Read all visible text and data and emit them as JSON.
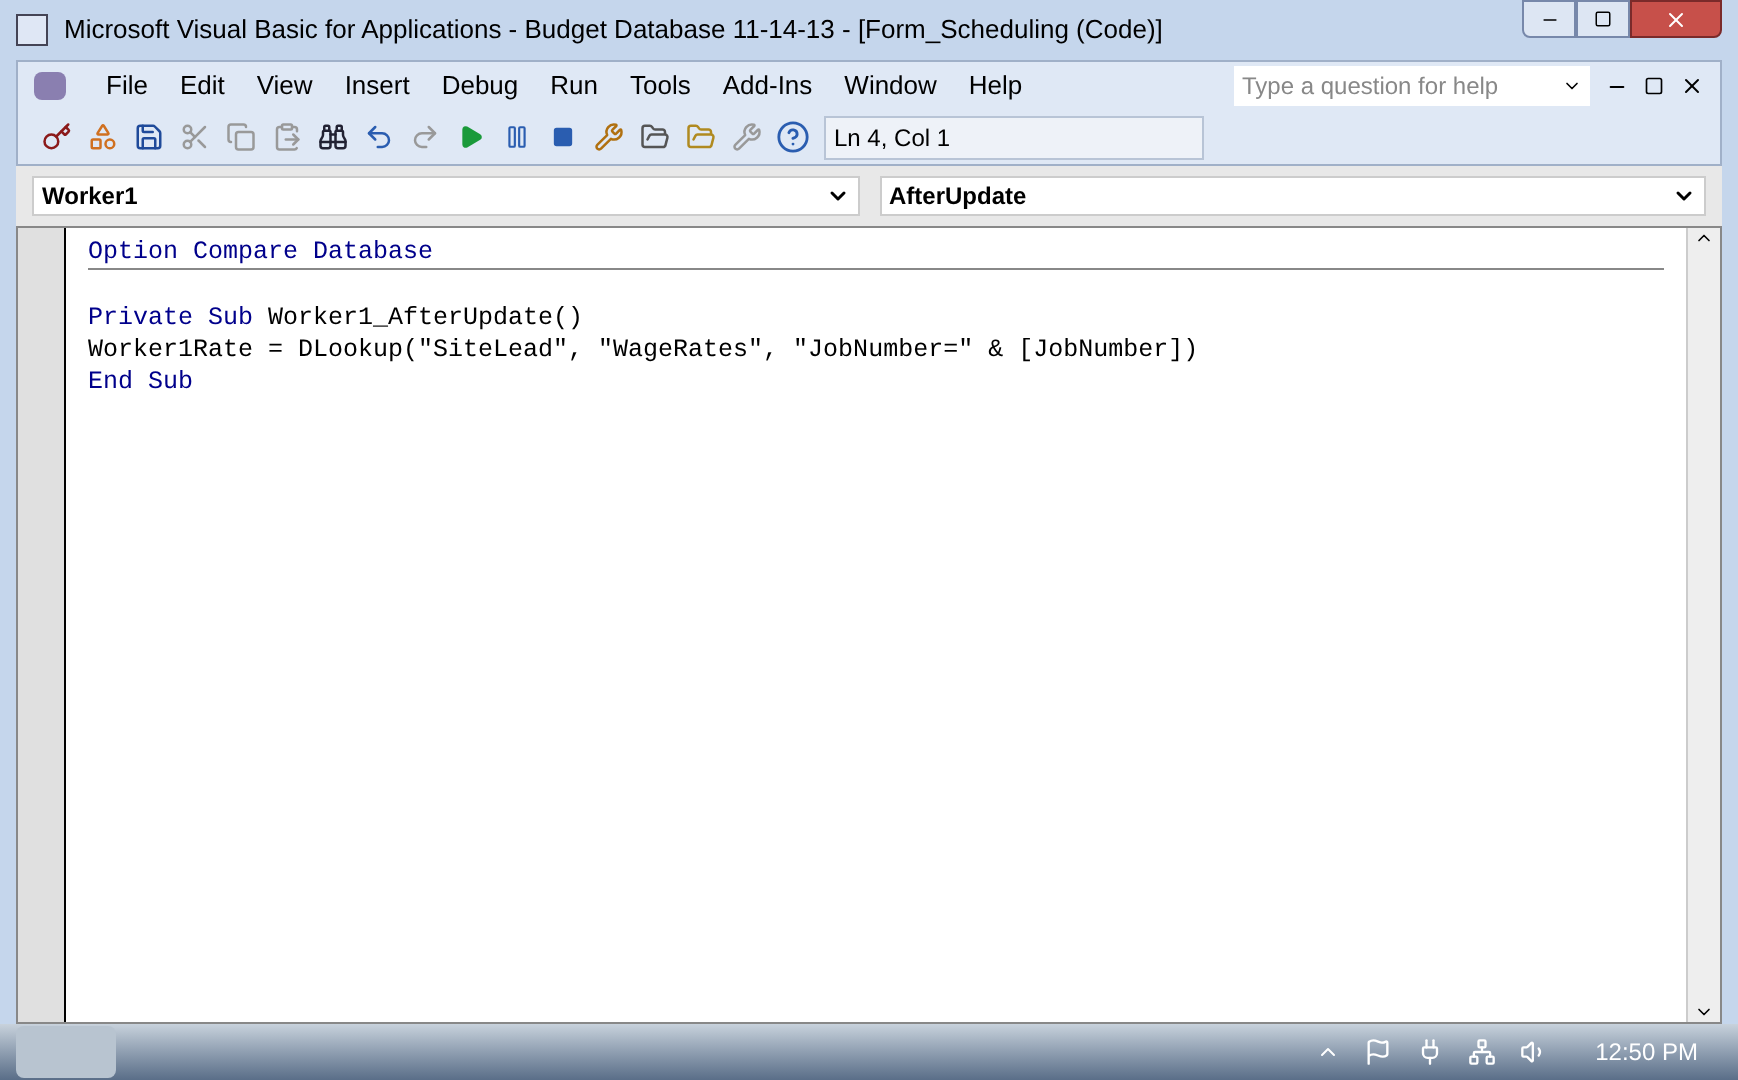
{
  "window": {
    "title": "Microsoft Visual Basic for Applications - Budget Database 11-14-13 - [Form_Scheduling (Code)]"
  },
  "menu": [
    "File",
    "Edit",
    "View",
    "Insert",
    "Debug",
    "Run",
    "Tools",
    "Add-Ins",
    "Window",
    "Help"
  ],
  "help_search": {
    "placeholder": "Type a question for help"
  },
  "toolbar": {
    "position": "Ln 4, Col 1"
  },
  "object_dropdown": {
    "value": "Worker1"
  },
  "procedure_dropdown": {
    "value": "AfterUpdate"
  },
  "code_lines": [
    [
      {
        "kind": "keyword",
        "text": "Option Compare Database"
      }
    ],
    [
      {
        "kind": "keyword",
        "text": "Private Sub"
      },
      {
        "kind": "plain",
        "text": " Worker1_AfterUpdate()"
      }
    ],
    [
      {
        "kind": "plain",
        "text": "Worker1Rate = DLookup(\"SiteLead\", \"WageRates\", \"JobNumber=\" & [JobNumber])"
      }
    ],
    [
      {
        "kind": "keyword",
        "text": "End Sub"
      }
    ]
  ],
  "taskbar": {
    "time": "12:50 PM"
  }
}
